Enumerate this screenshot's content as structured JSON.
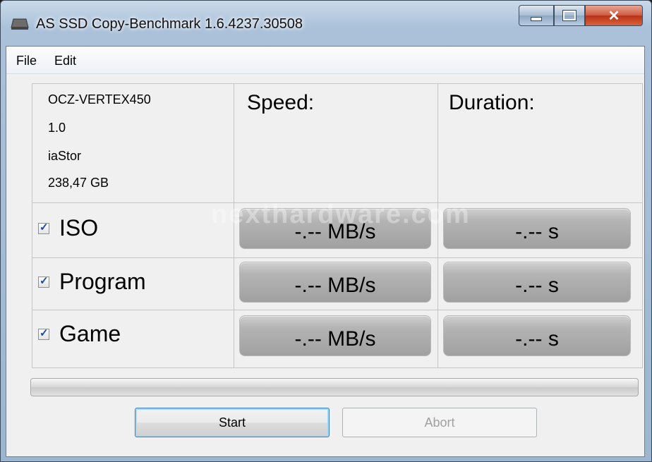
{
  "window": {
    "title": "AS SSD Copy-Benchmark 1.6.4237.30508"
  },
  "menu": {
    "file": "File",
    "edit": "Edit"
  },
  "drive": {
    "model": "OCZ-VERTEX450",
    "firmware": "1.0",
    "driver": "iaStor",
    "capacity": "238,47 GB"
  },
  "headers": {
    "speed": "Speed:",
    "duration": "Duration:"
  },
  "rows": [
    {
      "label": "ISO",
      "checked": true,
      "speed": "-.-- MB/s",
      "duration": "-.-- s"
    },
    {
      "label": "Program",
      "checked": true,
      "speed": "-.-- MB/s",
      "duration": "-.-- s"
    },
    {
      "label": "Game",
      "checked": true,
      "speed": "-.-- MB/s",
      "duration": "-.-- s"
    }
  ],
  "progress": {
    "value": 0
  },
  "buttons": {
    "start": "Start",
    "abort": "Abort"
  },
  "watermark": "nexthardware.com",
  "icons": {
    "app": "drive-icon",
    "minimize": "minimize-icon",
    "maximize": "maximize-icon",
    "close": "close-icon"
  }
}
